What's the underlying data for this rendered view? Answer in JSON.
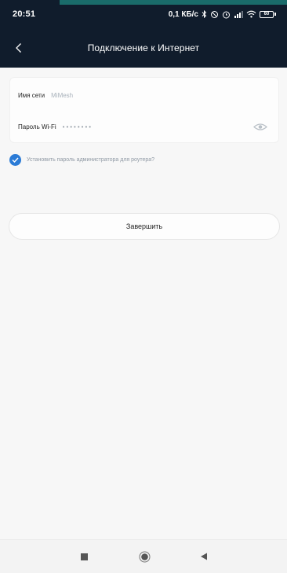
{
  "status_bar": {
    "time": "20:51",
    "speed": "0,1 КБ/с",
    "battery": "60"
  },
  "header": {
    "title": "Подключение к Интернет"
  },
  "form": {
    "network_name_label": "Имя сети",
    "network_name_value": "MiMesh",
    "password_label": "Пароль Wi-Fi",
    "password_value": "••••••••"
  },
  "admin_password": {
    "checked": true,
    "label": "Установить пароль администратора для роутера?"
  },
  "finish_button": {
    "label": "Завершить"
  },
  "colors": {
    "header_bg": "#101c2c",
    "accent": "#2b7bd6",
    "page_bg": "#f7f7f7"
  },
  "icons": [
    "back-arrow-icon",
    "eye-icon",
    "checkmark-icon",
    "recent-apps-icon",
    "home-icon",
    "nav-back-icon",
    "bluetooth-icon",
    "alarm-icon",
    "signal-icon",
    "wifi-icon",
    "battery-icon"
  ]
}
